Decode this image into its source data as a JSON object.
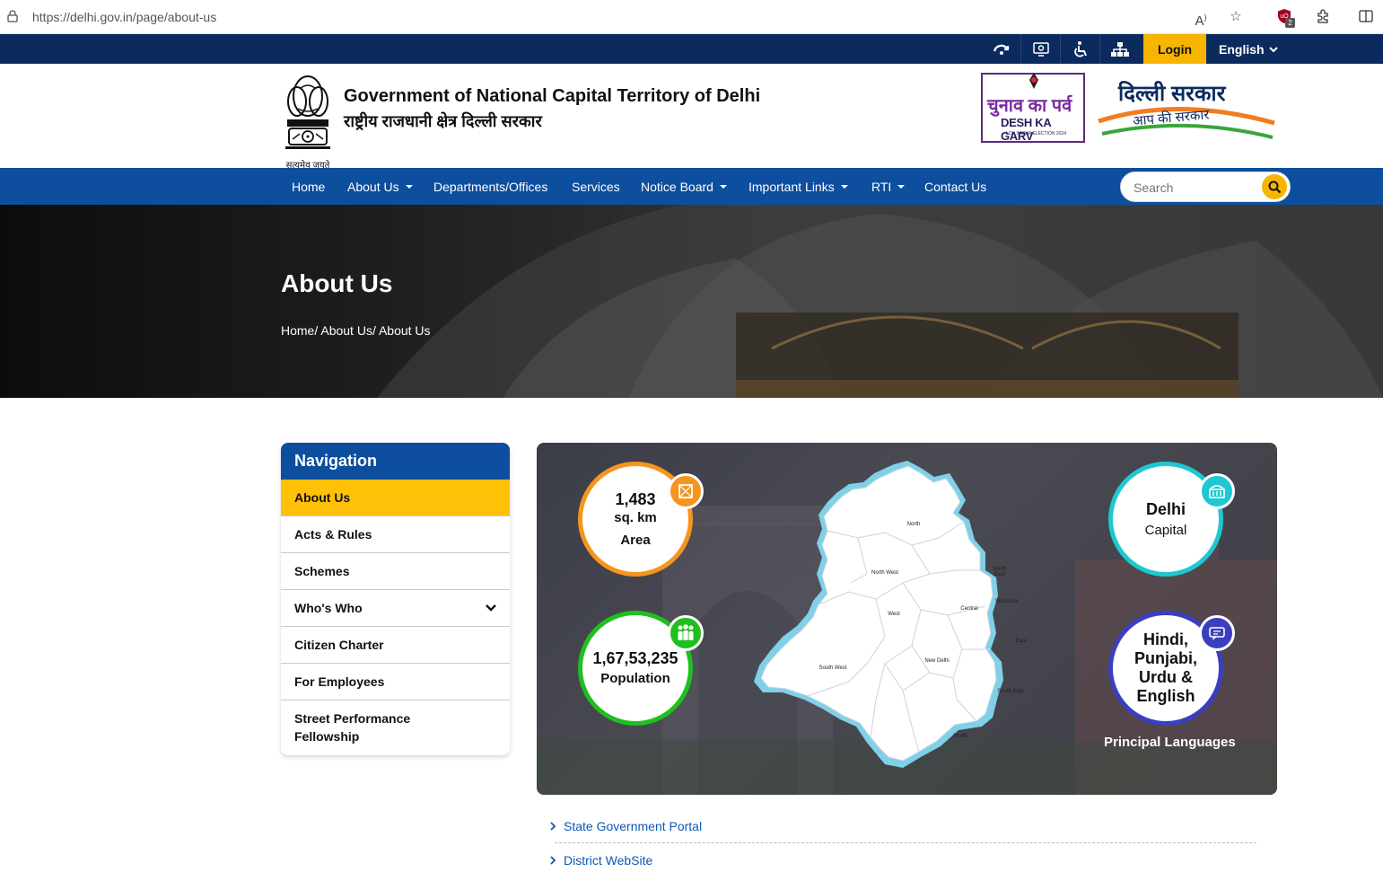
{
  "browser": {
    "url": "https://delhi.gov.in/page/about-us",
    "icons": [
      "lock-icon",
      "read-aloud-icon",
      "favorite-star-icon",
      "extension-shield-icon",
      "extensions-icon",
      "split-view-icon"
    ],
    "extension_badge": "2"
  },
  "topbar": {
    "icons": [
      "skip-content-icon",
      "screen-reader-icon",
      "accessibility-icon",
      "sitemap-icon"
    ],
    "login_label": "Login",
    "language_label": "English"
  },
  "header": {
    "title_en": "Government of National Capital Territory of Delhi",
    "title_hi": "राष्ट्रीय राजधानी क्षेत्र दिल्ली सरकार",
    "emblem_motto": "सत्यमेव जयते",
    "desh_line1": "चुनाव का पर्व",
    "desh_line2": "DESH KA GARV",
    "desh_line3": "LOK SABHA ELECTION 2024",
    "dilli_line1": "दिल्ली सरकार",
    "dilli_line2": "आप की सरकार"
  },
  "nav": {
    "items": [
      {
        "label": "Home",
        "dropdown": false
      },
      {
        "label": "About Us",
        "dropdown": true
      },
      {
        "label": "Departments/Offices",
        "dropdown": false
      },
      {
        "label": "Services",
        "dropdown": false
      },
      {
        "label": "Notice Board",
        "dropdown": true
      },
      {
        "label": "Important Links",
        "dropdown": true
      },
      {
        "label": "RTI",
        "dropdown": true
      },
      {
        "label": "Contact Us",
        "dropdown": false
      }
    ],
    "search_placeholder": "Search"
  },
  "hero": {
    "title": "About Us",
    "breadcrumb": "Home/ About Us/ About Us"
  },
  "sidenav": {
    "heading": "Navigation",
    "items": [
      {
        "label": "About Us",
        "active": true
      },
      {
        "label": "Acts & Rules"
      },
      {
        "label": "Schemes"
      },
      {
        "label": "Who's Who",
        "expandable": true
      },
      {
        "label": "Citizen Charter"
      },
      {
        "label": "For Employees"
      },
      {
        "label": "Street Performance Fellowship"
      }
    ]
  },
  "stats": {
    "area_value": "1,483",
    "area_unit": "sq. km",
    "area_label": "Area",
    "population_value": "1,67,53,235",
    "population_label": "Population",
    "capital_value": "Delhi",
    "capital_label": "Capital",
    "languages_value": "Hindi, Punjabi, Urdu & English",
    "languages_label": "Principal Languages",
    "map_districts": [
      "North",
      "North West",
      "North East",
      "Shahdara",
      "West",
      "Central",
      "East",
      "New Delhi",
      "South West",
      "South East",
      "South"
    ],
    "colors": {
      "area": "#f7941d",
      "population": "#1fbf1f",
      "capital": "#1ec8d2",
      "languages": "#3a3fc0"
    }
  },
  "links": [
    "State Government Portal",
    "District WebSite"
  ]
}
